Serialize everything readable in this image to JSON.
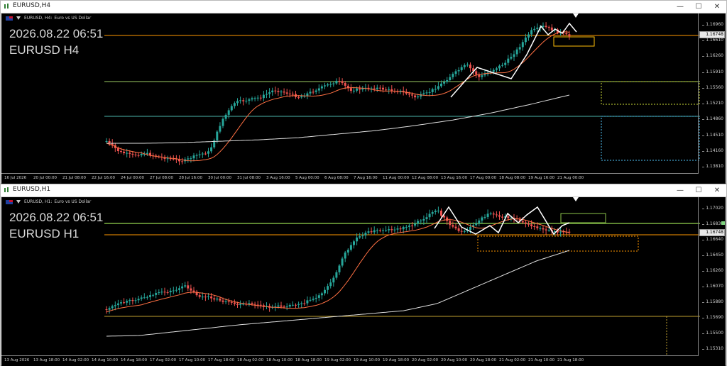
{
  "top": {
    "window_title": "EURUSD,H4",
    "header_symbol": "EURUSD, H4:",
    "header_desc": "Euro vs US Dollar",
    "overlay_datetime": "2026.08.22 06:51",
    "overlay_label": "EURUSD H4",
    "price_labels": [
      "1.16960",
      "1.16610",
      "1.16260",
      "1.15910",
      "1.15560",
      "1.15210",
      "1.14860",
      "1.14510",
      "1.14160",
      "1.13810"
    ],
    "current_price": "1.16748",
    "time_labels": [
      "16 Jul 2026",
      "20 Jul 00:00",
      "21 Jul 08:00",
      "22 Jul 16:00",
      "24 Jul 00:00",
      "27 Jul 08:00",
      "28 Jul 16:00",
      "30 Jul 00:00",
      "31 Jul 08:00",
      "3 Aug 16:00",
      "5 Aug 00:00",
      "6 Aug 08:00",
      "7 Aug 16:00",
      "11 Aug 00:00",
      "12 Aug 08:00",
      "13 Aug 16:00",
      "17 Aug 00:00",
      "18 Aug 08:00",
      "19 Aug 16:00",
      "21 Aug 00:00"
    ]
  },
  "bottom": {
    "window_title": "EURUSD,H1",
    "header_symbol": "EURUSD, H1:",
    "header_desc": "Euro vs US Dollar",
    "overlay_datetime": "2026.08.22 06:51",
    "overlay_label": "EURUSD H1",
    "price_labels": [
      "1.17020",
      "1.16830",
      "1.16640",
      "1.16450",
      "1.16260",
      "1.16070",
      "1.15880",
      "1.15690",
      "1.15500",
      "1.15310"
    ],
    "current_price": "1.16748",
    "time_labels": [
      "13 Aug 2026",
      "13 Aug 18:00",
      "14 Aug 02:00",
      "14 Aug 10:00",
      "14 Aug 18:00",
      "17 Aug 02:00",
      "17 Aug 10:00",
      "17 Aug 18:00",
      "18 Aug 02:00",
      "18 Aug 10:00",
      "18 Aug 18:00",
      "19 Aug 02:00",
      "19 Aug 10:00",
      "19 Aug 18:00",
      "20 Aug 02:00",
      "20 Aug 10:00",
      "20 Aug 18:00",
      "21 Aug 02:00",
      "21 Aug 10:00",
      "21 Aug 18:00"
    ]
  },
  "window_buttons": {
    "minimize": "—",
    "maximize": "☐",
    "close": "✕"
  },
  "colors": {
    "bull": "#26a69a",
    "bear": "#ef5350",
    "ma_fast": "#ff7043",
    "ma_slow": "#e0e0e0",
    "orange_line": "#ff9800",
    "green_line": "#9ccc65",
    "teal_line": "#4db6ac"
  }
}
